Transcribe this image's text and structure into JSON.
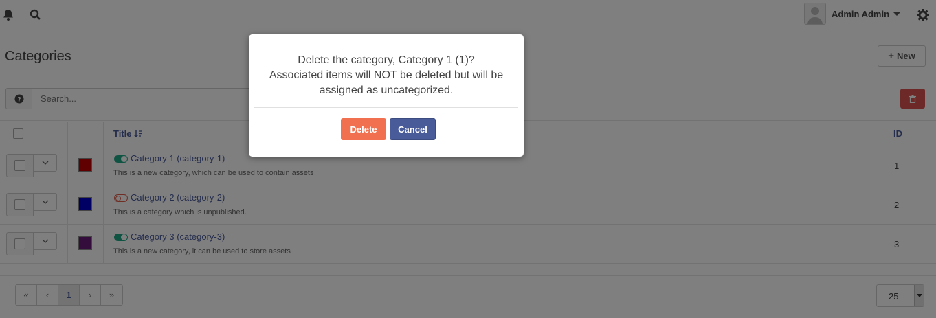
{
  "topbar": {
    "user_name": "Admin Admin",
    "icons": [
      "bell-icon",
      "search-icon",
      "avatar",
      "caret-down-icon",
      "gear-icon"
    ]
  },
  "page": {
    "title": "Categories",
    "new_button": "New"
  },
  "search": {
    "placeholder": "Search..."
  },
  "table": {
    "columns": {
      "title": "Title",
      "id": "ID"
    },
    "rows": [
      {
        "title": "Category 1 (category-1)",
        "description": "This is a new category, which can be used to contain assets",
        "id": "1",
        "color": "#c00000",
        "published": true
      },
      {
        "title": "Category 2 (category-2)",
        "description": "This is a category which is unpublished.",
        "id": "2",
        "color": "#0000c8",
        "published": false
      },
      {
        "title": "Category 3 (category-3)",
        "description": "This is a new category, it can be used to store assets",
        "id": "3",
        "color": "#6a1a7a",
        "published": true
      }
    ]
  },
  "pagination": {
    "first": "«",
    "prev": "‹",
    "current": "1",
    "next": "›",
    "last": "»",
    "per_page": "25"
  },
  "modal": {
    "line1": "Delete the category, Category 1 (1)?",
    "line2": "Associated items will NOT be deleted but will be assigned as uncategorized.",
    "delete_label": "Delete",
    "cancel_label": "Cancel"
  },
  "colors": {
    "accent": "#4a5b9a",
    "danger": "#d9534f",
    "delete_button": "#f0704f",
    "published": "#1ea784",
    "unpublished": "#e05a47"
  }
}
